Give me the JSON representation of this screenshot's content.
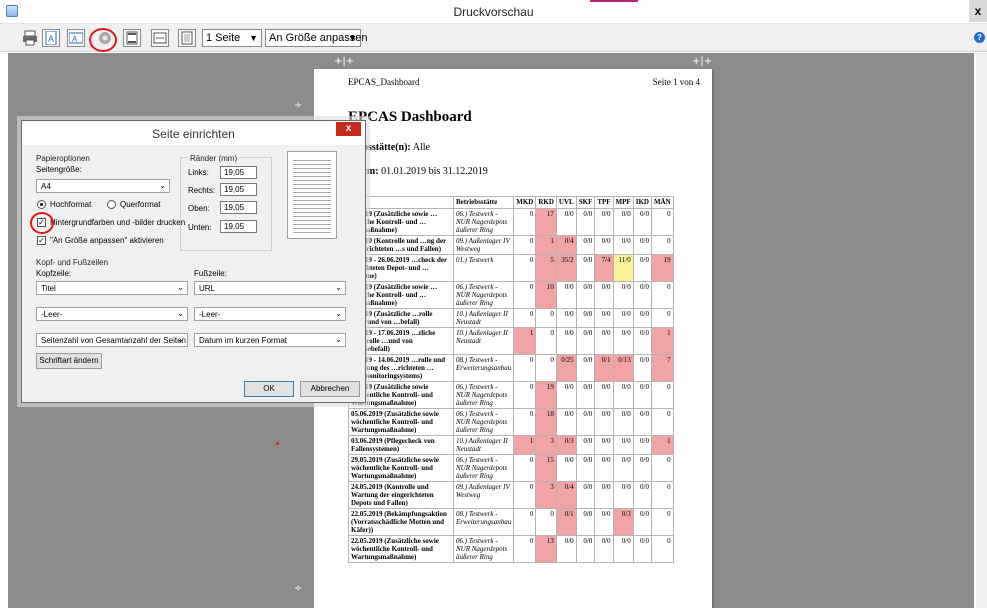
{
  "window": {
    "title": "Druckvorschau",
    "close": "x"
  },
  "toolbar": {
    "pages_select": "1 Seite",
    "fit_select": "An Größe anpassen",
    "help": "?"
  },
  "page": {
    "header_left": "EPCAS_Dashboard",
    "header_right": "Seite 1 von 4",
    "title": "EPCAS Dashboard",
    "meta_site_label": "…ebsstätte(n):",
    "meta_site_value": "Alle",
    "meta_date_label": "…tum:",
    "meta_date_value": "01.01.2019 bis 31.12.2019",
    "columns": [
      "…n",
      "Betriebsstätte",
      "MKD",
      "RKD",
      "UVL",
      "SKF",
      "TPF",
      "MPF",
      "IKD",
      "MÄN"
    ],
    "rows": [
      {
        "desc": "…2019 (Zusätzliche sowie …entliche Kontroll- und …ngsmaßnahme)",
        "site": "06.) Testwerk - NUR Nagerdepots äußerer Ring",
        "vals": [
          "0",
          "17",
          "0/0",
          "0/0",
          "0/0",
          "0/0",
          "0/0",
          "0"
        ],
        "hl": [
          "",
          "r",
          "",
          "",
          "",
          "",
          "",
          ""
        ]
      },
      {
        "desc": "…2010 (Kontrolle und …ng der eingerichteten …s und Fallen)",
        "site": "09.) Außenlager IV Westweg",
        "vals": [
          "0",
          "1",
          "0/4",
          "0/0",
          "0/0",
          "0/0",
          "0/0",
          "0"
        ],
        "hl": [
          "",
          "r",
          "r",
          "",
          "",
          "",
          "",
          ""
        ]
      },
      {
        "desc": "…2019 - 26.06.2019 …check der …richteten Depot- und …systeme)",
        "site": "01.) Testwerk",
        "vals": [
          "0",
          "5",
          "35/2",
          "0/0",
          "7/4",
          "11/0",
          "0/0",
          "19"
        ],
        "hl": [
          "",
          "r",
          "r",
          "",
          "r",
          "y",
          "",
          "r"
        ]
      },
      {
        "desc": "…2019 (Zusätzliche sowie …entliche Kontroll- und …ngsmaßnahme)",
        "site": "06.) Testwerk - NUR Nagerdepots äußerer Ring",
        "vals": [
          "0",
          "10",
          "0/0",
          "0/0",
          "0/0",
          "0/0",
          "0/0",
          "0"
        ],
        "hl": [
          "",
          "r",
          "",
          "",
          "",
          "",
          "",
          ""
        ]
      },
      {
        "desc": "…2019 (Zusätzliche …rolle aufgrund von …befall)",
        "site": "10.) Außenlager II Neustadt",
        "vals": [
          "0",
          "0",
          "0/0",
          "0/0",
          "0/0",
          "0/0",
          "0/0",
          "0"
        ],
        "hl": [
          "",
          "",
          "",
          "",
          "",
          "",
          "",
          ""
        ]
      },
      {
        "desc": "…2019 - 17.06.2019 …zliche Kontrolle …und von Mäusebefall)",
        "site": "10.) Außenlager II Neustadt",
        "vals": [
          "1",
          "0",
          "0/0",
          "0/0",
          "0/0",
          "0/0",
          "0/0",
          "1"
        ],
        "hl": [
          "r",
          "",
          "",
          "",
          "",
          "",
          "",
          "r"
        ]
      },
      {
        "desc": "…2019 - 14.06.2019 …rolle und Wartung des …richteten …fallsmonitoringsystems)",
        "site": "08.) Testwerk - Erweiterungsanbau",
        "vals": [
          "0",
          "0",
          "0/25",
          "0/0",
          "0/1",
          "0/13",
          "0/0",
          "7"
        ],
        "hl": [
          "",
          "",
          "r",
          "",
          "r",
          "r",
          "",
          "r"
        ]
      },
      {
        "desc": "…2019 (Zusätzliche sowie wöchentliche Kontroll- und Wartungsmaßnahme)",
        "site": "06.) Testwerk - NUR Nagerdepots äußerer Ring",
        "vals": [
          "0",
          "19",
          "0/0",
          "0/0",
          "0/0",
          "0/0",
          "0/0",
          "0"
        ],
        "hl": [
          "",
          "r",
          "",
          "",
          "",
          "",
          "",
          ""
        ]
      },
      {
        "desc": "05.06.2019 (Zusätzliche sowie wöchentliche Kontroll- und Wartungsmaßnahme)",
        "site": "06.) Testwerk - NUR Nagerdepots äußerer Ring",
        "vals": [
          "0",
          "18",
          "0/0",
          "0/0",
          "0/0",
          "0/0",
          "0/0",
          "0"
        ],
        "hl": [
          "",
          "r",
          "",
          "",
          "",
          "",
          "",
          ""
        ]
      },
      {
        "desc": "03.06.2019 (Pflegecheck von Fallensystemen)",
        "site": "10.) Außenlager II Neustadt",
        "vals": [
          "1",
          "3",
          "0/3",
          "0/0",
          "0/0",
          "0/0",
          "0/0",
          "1"
        ],
        "hl": [
          "r",
          "r",
          "r",
          "",
          "",
          "",
          "",
          "r"
        ]
      },
      {
        "desc": "29.05.2019 (Zusätzliche sowie wöchentliche Kontroll- und Wartungsmaßnahme)",
        "site": "06.) Testwerk - NUR Nagerdepots äußerer Ring",
        "vals": [
          "0",
          "15",
          "0/0",
          "0/0",
          "0/0",
          "0/0",
          "0/0",
          "0"
        ],
        "hl": [
          "",
          "r",
          "",
          "",
          "",
          "",
          "",
          ""
        ]
      },
      {
        "desc": "24.05.2019 (Kontrolle und Wartung der eingerichteten Depots und Fallen)",
        "site": "09.) Außenlager IV Westweg",
        "vals": [
          "0",
          "3",
          "0/4",
          "0/0",
          "0/0",
          "0/0",
          "0/0",
          "0"
        ],
        "hl": [
          "",
          "r",
          "r",
          "",
          "",
          "",
          "",
          ""
        ]
      },
      {
        "desc": "22.05.2019 (Bekämpfungsaktion (Vorratsschädliche Motten und Käfer))",
        "site": "08.) Testwerk - Erweiterungsanbau",
        "vals": [
          "0",
          "0",
          "0/1",
          "0/0",
          "0/0",
          "0/3",
          "0/0",
          "0"
        ],
        "hl": [
          "",
          "",
          "r",
          "",
          "",
          "r",
          "",
          ""
        ]
      },
      {
        "desc": "22.05.2019 (Zusätzliche sowie wöchentliche Kontroll- und Wartungsmaßnahme)",
        "site": "06.) Testwerk - NUR Nagerdepots äußerer Ring",
        "vals": [
          "0",
          "13",
          "0/0",
          "0/0",
          "0/0",
          "0/0",
          "0/0",
          "0"
        ],
        "hl": [
          "",
          "r",
          "",
          "",
          "",
          "",
          "",
          ""
        ]
      }
    ]
  },
  "dialog": {
    "title": "Seite einrichten",
    "close": "x",
    "paper_options": "Papieroptionen",
    "paper_size_label": "Seitengröße:",
    "paper_size": "A4",
    "portrait": "Hochformat",
    "landscape": "Querformat",
    "print_bg": "Hintergrundfarben und -bilder drucken",
    "shrink_to_fit": "\"An Größe anpassen\" aktivieren",
    "margins": "Ränder (mm)",
    "left_label": "Links:",
    "left_value": "19,05",
    "right_label": "Rechts:",
    "right_value": "19,05",
    "top_label": "Oben:",
    "top_value": "19,05",
    "bottom_label": "Unten:",
    "bottom_value": "19,05",
    "headers_footers": "Kopf- und Fußzeilen",
    "header_label": "Kopfzeile:",
    "footer_label": "Fußzeile:",
    "header1": "Titel",
    "header2": "-Leer-",
    "header3": "Seitenzahl von Gesamtanzahl der Seiten",
    "footer1": "URL",
    "footer2": "-Leer-",
    "footer3": "Datum im kurzen Format",
    "change_font": "Schriftart ändern",
    "ok": "OK",
    "cancel": "Abbrechen"
  },
  "colors": {
    "highlight_red": "#f2a3a3",
    "highlight_yellow": "#fbf29a",
    "annotation_red": "#e0161b"
  }
}
